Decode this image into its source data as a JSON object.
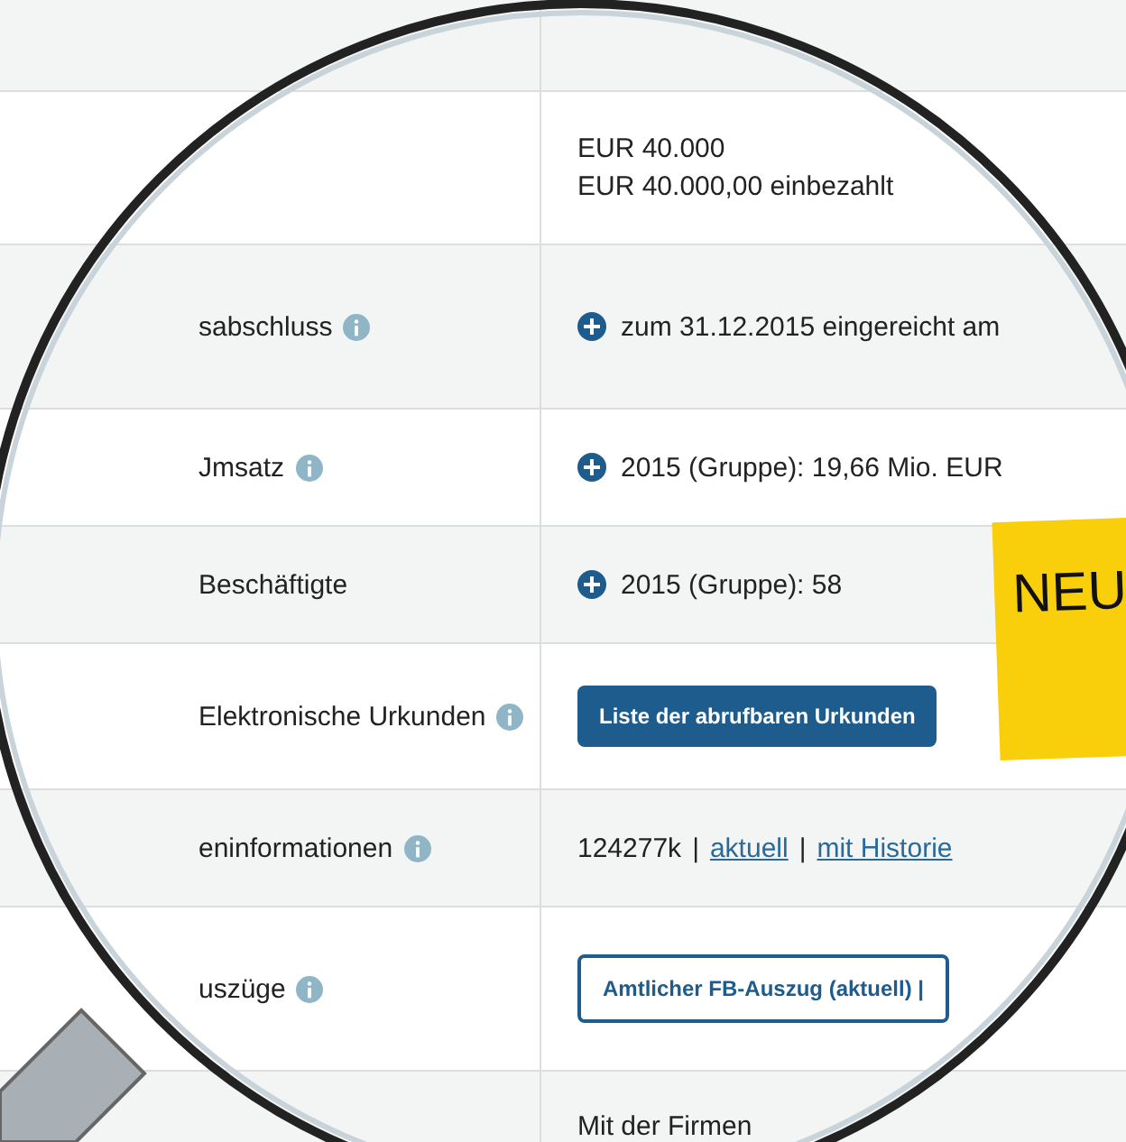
{
  "rows": [
    {
      "label": "",
      "info": false,
      "values": []
    },
    {
      "label": "",
      "info": false,
      "values": [
        {
          "kind": "text",
          "text": "EUR 40.000"
        },
        {
          "kind": "text",
          "text": "EUR 40.000,00 einbezahlt"
        }
      ]
    },
    {
      "label": "sabschluss",
      "info": true,
      "values": [
        {
          "kind": "expand",
          "text": "zum 31.12.2015 eingereicht am"
        }
      ]
    },
    {
      "label": "Jmsatz",
      "info": true,
      "values": [
        {
          "kind": "expand",
          "text": "2015 (Gruppe): 19,66 Mio. EUR"
        }
      ]
    },
    {
      "label": "Beschäftigte",
      "info": false,
      "values": [
        {
          "kind": "expand",
          "text": "2015 (Gruppe): 58"
        }
      ]
    },
    {
      "label": "Elektronische Urkunden",
      "info": true,
      "values": [
        {
          "kind": "primary",
          "text": "Liste der abrufbaren Urkunden"
        }
      ]
    },
    {
      "label": "eninformationen",
      "info": true,
      "values": [
        {
          "kind": "links",
          "parts": [
            {
              "text": "124277k",
              "link": false
            },
            {
              "text": "|",
              "link": false
            },
            {
              "text": "aktuell",
              "link": true
            },
            {
              "text": "|",
              "link": false
            },
            {
              "text": "mit Historie",
              "link": true
            }
          ]
        }
      ]
    },
    {
      "label": "uszüge",
      "info": true,
      "values": [
        {
          "kind": "outline",
          "text": "Amtlicher FB-Auszug (aktuell) |"
        }
      ]
    },
    {
      "label": "",
      "info": false,
      "values": [
        {
          "kind": "text",
          "text": "Mit der Firmen"
        }
      ]
    }
  ],
  "badge": {
    "text": "NEU"
  }
}
